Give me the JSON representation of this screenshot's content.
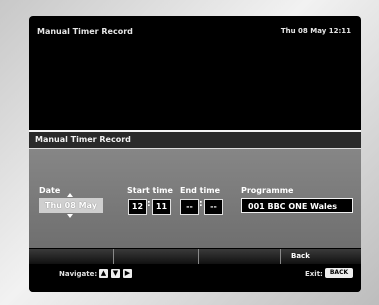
{
  "header": {
    "title": "Manual Timer Record",
    "clock": "Thu 08 May   12:11"
  },
  "panel": {
    "title": "Manual Timer Record",
    "date_label": "Date",
    "date_value": "Thu 08 May",
    "start_label": "Start time",
    "start_hour": "12",
    "start_min": "11",
    "end_label": "End time",
    "end_hour": "--",
    "end_min": "--",
    "programme_label": "Programme",
    "programme_value": "001  BBC ONE Wales"
  },
  "keybar": {
    "back_label": "Back"
  },
  "footer": {
    "navigate_label": "Navigate:",
    "nav_icons": [
      "up-arrow-icon",
      "down-arrow-icon",
      "right-arrow-icon"
    ],
    "exit_label": "Exit:",
    "exit_button": "BACK"
  }
}
